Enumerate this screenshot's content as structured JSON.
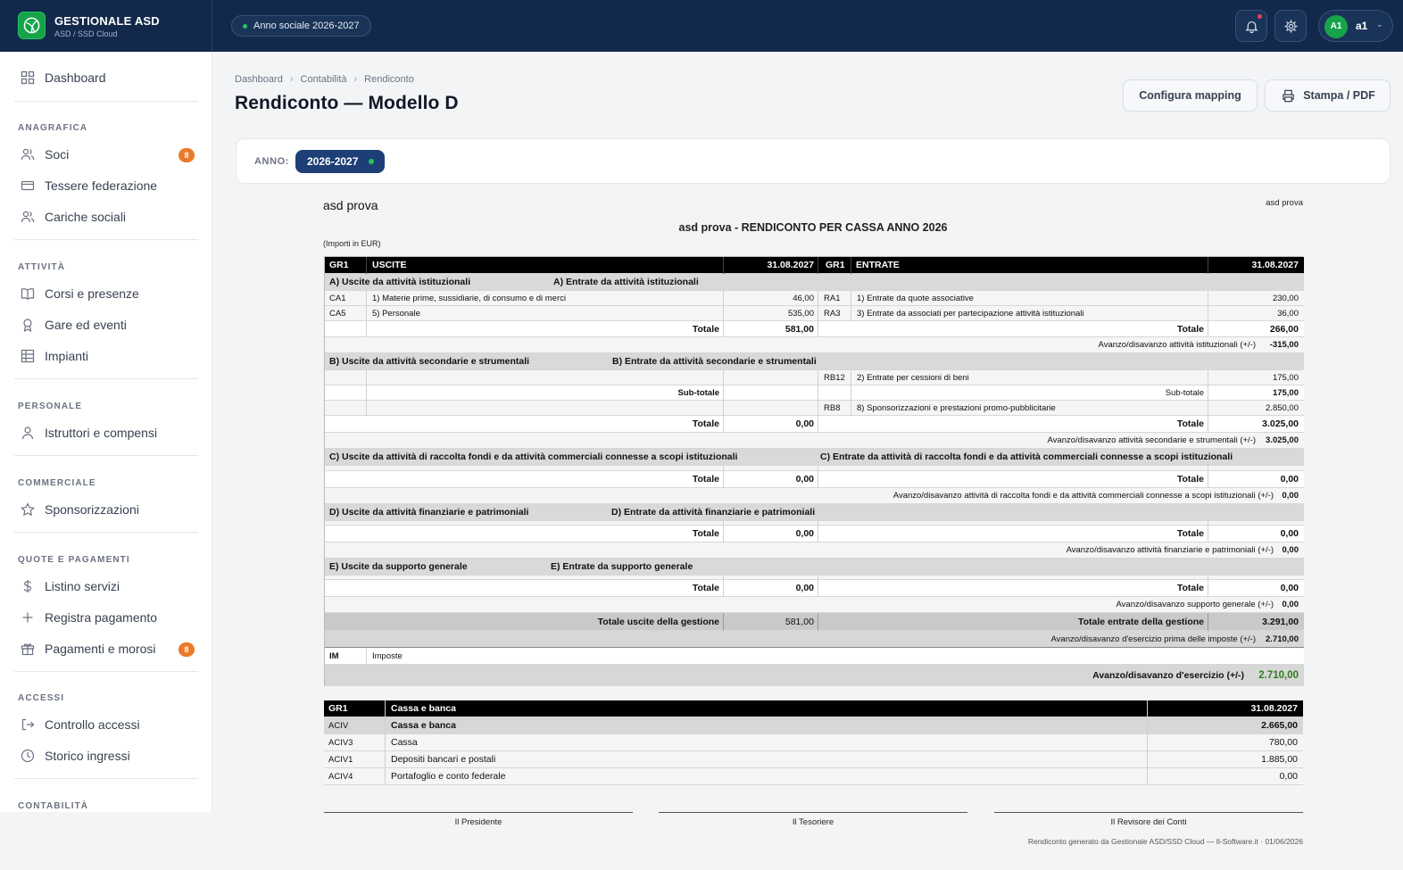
{
  "brand": {
    "name": "GESTIONALE ASD",
    "subtitle": "ASD / SSD Cloud"
  },
  "topbar": {
    "season": "Anno sociale 2026-2027",
    "user_initials": "A1",
    "user_name": "a1"
  },
  "sidebar": {
    "dashboard": "Dashboard",
    "sections": [
      {
        "title": "ANAGRAFICA",
        "items": [
          {
            "label": "Soci",
            "badge": "8"
          },
          {
            "label": "Tessere federazione"
          },
          {
            "label": "Cariche sociali"
          }
        ]
      },
      {
        "title": "ATTIVITÀ",
        "items": [
          {
            "label": "Corsi e presenze"
          },
          {
            "label": "Gare ed eventi"
          },
          {
            "label": "Impianti"
          }
        ]
      },
      {
        "title": "PERSONALE",
        "items": [
          {
            "label": "Istruttori e compensi"
          }
        ]
      },
      {
        "title": "COMMERCIALE",
        "items": [
          {
            "label": "Sponsorizzazioni"
          }
        ]
      },
      {
        "title": "QUOTE E PAGAMENTI",
        "items": [
          {
            "label": "Listino servizi"
          },
          {
            "label": "Registra pagamento"
          },
          {
            "label": "Pagamenti e morosi",
            "badge": "8"
          }
        ]
      },
      {
        "title": "ACCESSI",
        "items": [
          {
            "label": "Controllo accessi"
          },
          {
            "label": "Storico ingressi"
          }
        ]
      },
      {
        "title": "CONTABILITÀ",
        "items": []
      }
    ]
  },
  "breadcrumb": [
    "Dashboard",
    "Contabilità",
    "Rendiconto"
  ],
  "page": {
    "title": "Rendiconto — Modello D",
    "btn_mapping": "Configura mapping",
    "btn_print": "Stampa / PDF"
  },
  "year": {
    "label": "ANNO:",
    "value": "2026-2027"
  },
  "report": {
    "org": "asd prova",
    "org_right": "asd prova",
    "title": "asd prova - RENDICONTO PER CASSA ANNO 2026",
    "units": "(Importi in EUR)",
    "head": {
      "gr": "GR1",
      "uscite": "USCITE",
      "date": "31.08.2027",
      "entrate": "ENTRATE"
    },
    "A": {
      "title_u": "A) Uscite da attività istituzionali",
      "title_e": "A) Entrate da attività istituzionali",
      "rows": [
        {
          "cu": "CA1",
          "du": "1) Materie prime, sussidiarie, di consumo e di merci",
          "vu": "46,00",
          "ce": "RA1",
          "de": "1) Entrate da quote associative",
          "ve": "230,00"
        },
        {
          "cu": "CA5",
          "du": "5) Personale",
          "vu": "535,00",
          "ce": "RA3",
          "de": "3) Entrate da associati per partecipazione attività istituzionali",
          "ve": "36,00"
        }
      ],
      "tot_label": "Totale",
      "tot_u": "581,00",
      "tot_e": "266,00",
      "av_label": "Avanzo/disavanzo attività istituzionali (+/-)",
      "av": "-315,00"
    },
    "B": {
      "title_u": "B) Uscite da attività secondarie e strumentali",
      "title_e": "B) Entrate da attività secondarie e strumentali",
      "r1": {
        "ce": "RB12",
        "de": "2) Entrate per cessioni di beni",
        "ve": "175,00"
      },
      "sub_label": "Sub-totale",
      "sub_e": "175,00",
      "r2": {
        "ce": "RB8",
        "de": "8) Sponsorizzazioni e prestazioni promo-pubblicitarie",
        "ve": "2.850,00"
      },
      "tot_label": "Totale",
      "tot_u": "0,00",
      "tot_e": "3.025,00",
      "av_label": "Avanzo/disavanzo attività secondarie e strumentali (+/-)",
      "av": "3.025,00"
    },
    "C": {
      "title_u": "C) Uscite da attività di raccolta fondi e da attività commerciali connesse a scopi istituzionali",
      "title_e": "C) Entrate da attività di raccolta fondi e da attività commerciali connesse a scopi istituzionali",
      "tot_label": "Totale",
      "tot_u": "0,00",
      "tot_e": "0,00",
      "av_label": "Avanzo/disavanzo attività di raccolta fondi e da attività commerciali connesse a scopi istituzionali (+/-)",
      "av": "0,00"
    },
    "D": {
      "title_u": "D) Uscite da attività finanziarie e patrimoniali",
      "title_e": "D) Entrate da attività finanziarie e patrimoniali",
      "tot_label": "Totale",
      "tot_u": "0,00",
      "tot_e": "0,00",
      "av_label": "Avanzo/disavanzo attività finanziarie e patrimoniali (+/-)",
      "av": "0,00"
    },
    "E": {
      "title_u": "E) Uscite da supporto generale",
      "title_e": "E) Entrate da supporto generale",
      "tot_label": "Totale",
      "tot_u": "0,00",
      "tot_e": "0,00",
      "av_label": "Avanzo/disavanzo supporto generale (+/-)",
      "av": "0,00"
    },
    "gestione": {
      "label_u": "Totale uscite della gestione",
      "tot_u": "581,00",
      "label_e": "Totale entrate della gestione",
      "tot_e": "3.291,00",
      "av_label": "Avanzo/disavanzo d'esercizio prima delle imposte (+/-)",
      "av": "2.710,00"
    },
    "imposte": {
      "code": "IM",
      "label": "Imposte"
    },
    "finale": {
      "label": "Avanzo/disavanzo d'esercizio (+/-)",
      "value": "2.710,00"
    },
    "cassa": {
      "head": {
        "gr": "GR1",
        "title": "Cassa e banca",
        "date": "31.08.2027"
      },
      "rows": [
        {
          "code": "ACIV",
          "label": "Cassa e banca",
          "value": "2.665,00"
        },
        {
          "code": "ACIV3",
          "label": "Cassa",
          "value": "780,00"
        },
        {
          "code": "ACIV1",
          "label": "Depositi bancari e postali",
          "value": "1.885,00"
        },
        {
          "code": "ACIV4",
          "label": "Portafoglio e conto federale",
          "value": "0,00"
        }
      ]
    },
    "signatures": [
      "Il Presidente",
      "Il Tesoriere",
      "Il Revisore dei Conti"
    ],
    "footer": "Rendiconto generato da Gestionale ASD/SSD Cloud — Il-Software.it  ·  01/06/2026"
  },
  "colors": {
    "topbar": "#13294b",
    "accent_green": "#16a34a",
    "badge": "#ea7a2a",
    "year_pill": "#1e3f75"
  }
}
